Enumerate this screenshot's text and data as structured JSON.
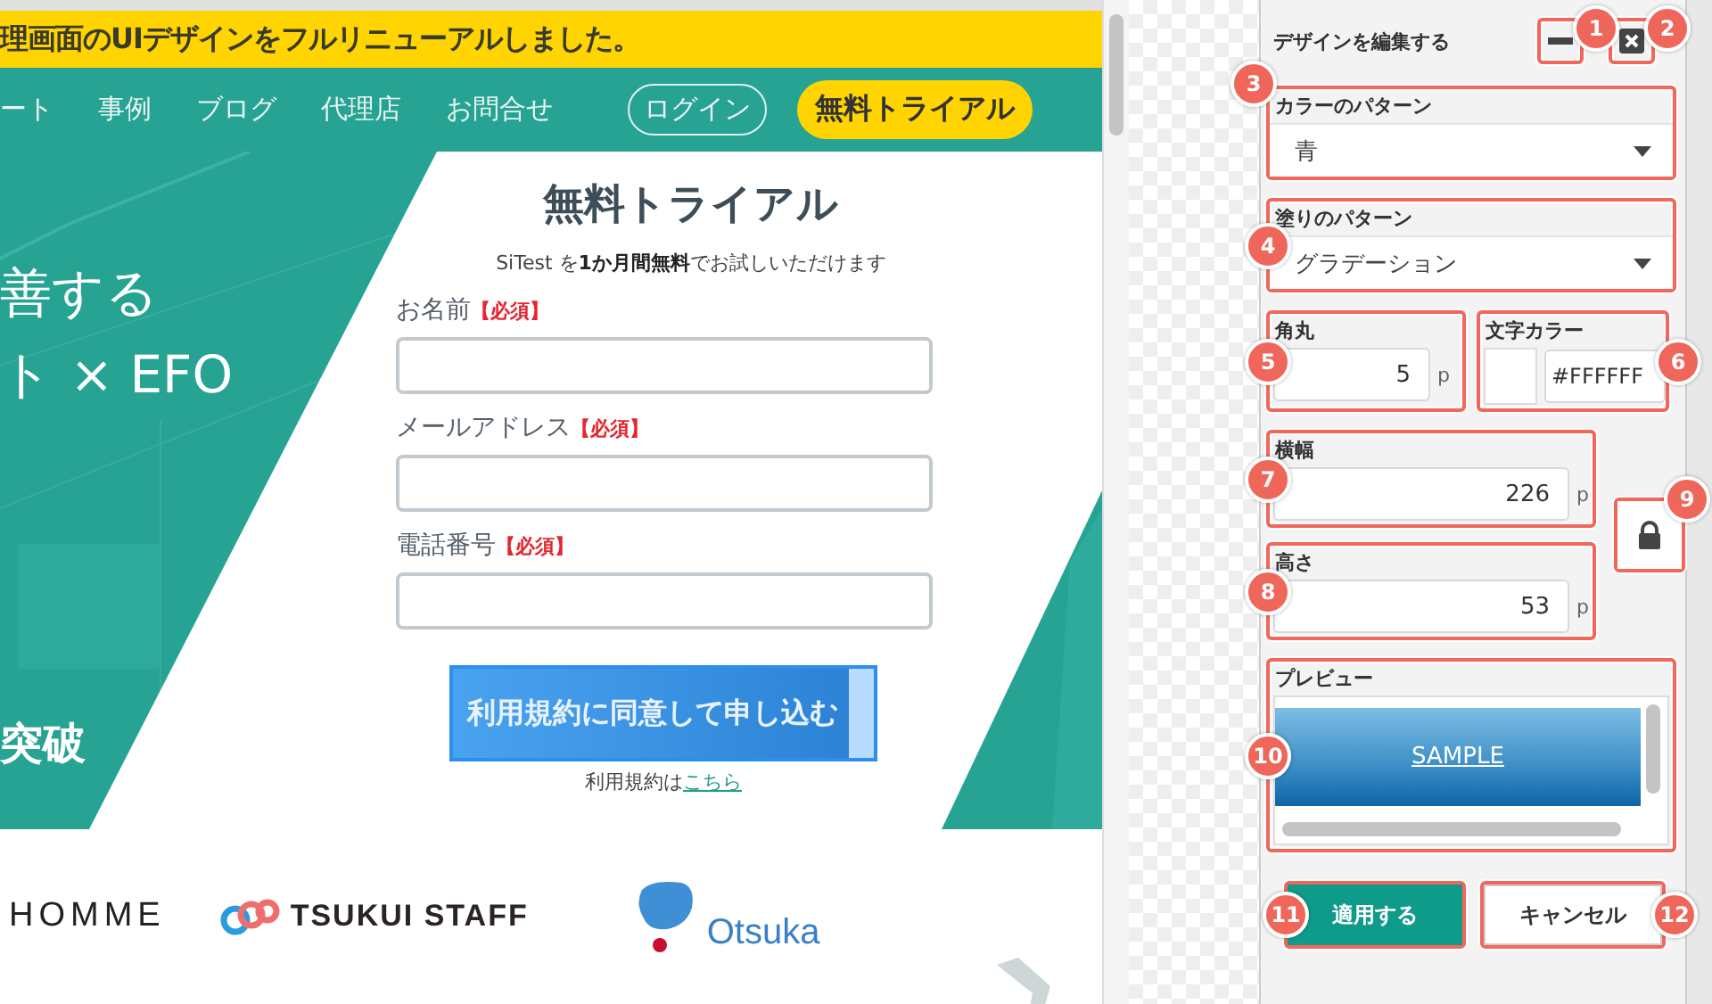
{
  "banner": {
    "text": "理画面のUIデザインをフルリニューアルしました。"
  },
  "nav": {
    "items": [
      "ート",
      "事例",
      "ブログ",
      "代理店",
      "お問合せ"
    ],
    "login": "ログイン",
    "trial": "無料トライアル"
  },
  "hero": {
    "lines": [
      "善する",
      "ト × EFO"
    ],
    "tagline": "突破"
  },
  "form": {
    "title": "無料トライアル",
    "subtitle": "SiTest を**1か月間無料**でお試しいただけます",
    "fields": [
      {
        "label": "お名前",
        "required": "【必須】"
      },
      {
        "label": "メールアドレス",
        "required": "【必須】"
      },
      {
        "label": "電話番号",
        "required": "【必須】"
      }
    ],
    "submit": "利用規約に同意して申し込む",
    "terms": {
      "text": "利用規約は",
      "link": "こちら"
    }
  },
  "logos": [
    {
      "kind": "wordmark",
      "text": "HOMME"
    },
    {
      "kind": "rings",
      "text": "TSUKUI STAFF"
    },
    {
      "kind": "drop",
      "text": "Otsuka"
    }
  ],
  "panel": {
    "title": "デザインを編集する",
    "minimize": {
      "callout": "1"
    },
    "close": {
      "callout": "2"
    },
    "color_pattern": {
      "label": "カラーのパターン",
      "value": "青",
      "callout": "3"
    },
    "fill_pattern": {
      "label": "塗りのパターン",
      "value": "グラデーション",
      "callout": "4"
    },
    "radius": {
      "label": "角丸",
      "value": "5",
      "unit": "p",
      "callout": "5"
    },
    "text_color": {
      "label": "文字カラー",
      "value": "#FFFFFF",
      "color": "#ffffff",
      "callout": "6"
    },
    "width": {
      "label": "横幅",
      "value": "226",
      "unit": "p",
      "callout": "7"
    },
    "height": {
      "label": "高さ",
      "value": "53",
      "unit": "p",
      "callout": "8"
    },
    "lock": {
      "callout": "9"
    },
    "preview": {
      "label": "プレビュー",
      "sample": "SAMPLE",
      "callout": "10"
    },
    "apply": {
      "label": "適用する",
      "callout": "11"
    },
    "cancel": {
      "label": "キャンセル",
      "callout": "12"
    }
  }
}
